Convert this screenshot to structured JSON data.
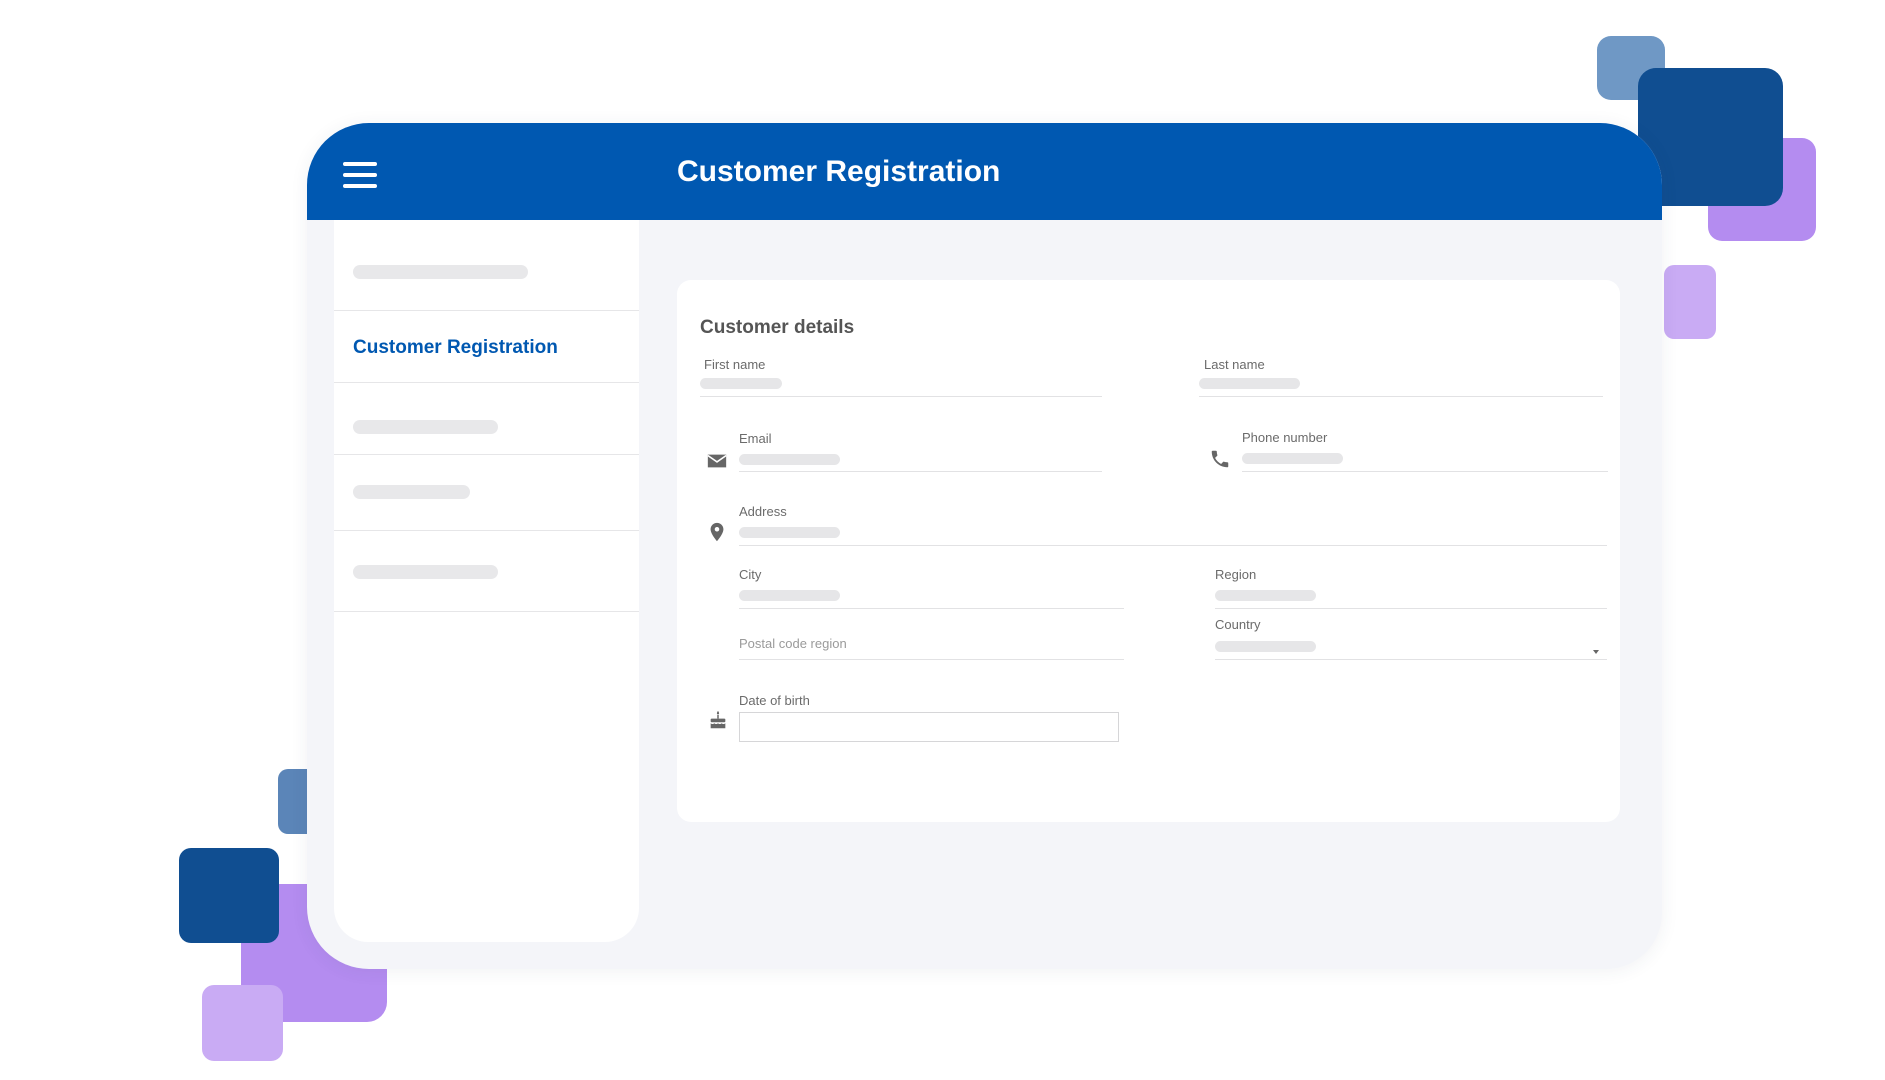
{
  "colors": {
    "header_bg": "#0058b1",
    "accent": "#0058b1",
    "window_bg": "#f4f5f9",
    "deco_blue_light": "#6f98c5",
    "deco_blue_dark": "#104e91",
    "deco_purple": "#b48cf0",
    "deco_lavender": "#c9abf4",
    "deco_blue_mid": "#5b85b8"
  },
  "header": {
    "title": "Customer Registration",
    "menu_icon": "hamburger-menu-icon"
  },
  "sidebar": {
    "active_item": "Customer Registration"
  },
  "form": {
    "title": "Customer details",
    "fields": {
      "first_name": {
        "label": "First name"
      },
      "last_name": {
        "label": "Last name"
      },
      "email": {
        "label": "Email",
        "icon": "envelope-icon"
      },
      "phone": {
        "label": "Phone number",
        "icon": "phone-icon"
      },
      "address": {
        "label": "Address",
        "icon": "location-pin-icon"
      },
      "city": {
        "label": "City"
      },
      "region": {
        "label": "Region"
      },
      "postal_code": {
        "placeholder": "Postal code region"
      },
      "country": {
        "label": "Country"
      },
      "date_of_birth": {
        "label": "Date of birth",
        "icon": "birthday-cake-icon",
        "value": ""
      }
    }
  }
}
